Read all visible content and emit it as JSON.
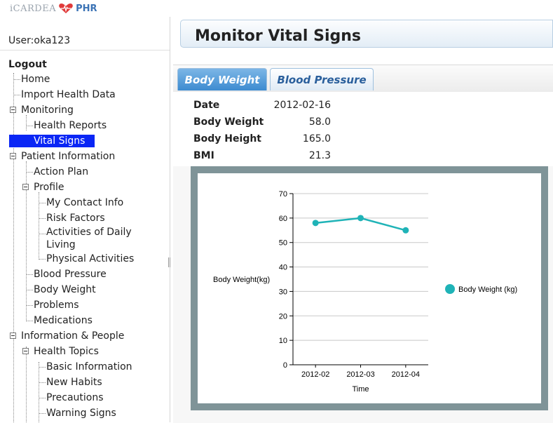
{
  "brand": {
    "name": "iCARDEA",
    "suffix": "PHR",
    "heart_color": "#e03a3a"
  },
  "sidebar": {
    "user_label": "User:",
    "username": "oka123",
    "logout": "Logout",
    "items": [
      {
        "label": "Home"
      },
      {
        "label": "Import Health Data"
      },
      {
        "label": "Monitoring"
      },
      {
        "label": "Health Reports"
      },
      {
        "label": "Vital Signs"
      },
      {
        "label": "Patient Information"
      },
      {
        "label": "Action Plan"
      },
      {
        "label": "Profile"
      },
      {
        "label": "My Contact Info"
      },
      {
        "label": "Risk Factors"
      },
      {
        "label": "Activities of Daily"
      },
      {
        "label": "Living"
      },
      {
        "label": "Physical Activities"
      },
      {
        "label": "Blood Pressure"
      },
      {
        "label": "Body Weight"
      },
      {
        "label": "Problems"
      },
      {
        "label": "Medications"
      },
      {
        "label": "Information & People"
      },
      {
        "label": "Health Topics"
      },
      {
        "label": "Basic Information"
      },
      {
        "label": "New Habits"
      },
      {
        "label": "Precautions"
      },
      {
        "label": "Warning Signs"
      }
    ]
  },
  "main": {
    "title": "Monitor Vital Signs",
    "tabs": [
      {
        "label": "Body Weight",
        "active": true
      },
      {
        "label": "Blood Pressure",
        "active": false
      }
    ],
    "info": {
      "date_label": "Date",
      "date_value": "2012-02-16",
      "weight_label": "Body Weight",
      "weight_value": "58.0",
      "height_label": "Body Height",
      "height_value": "165.0",
      "bmi_label": "BMI",
      "bmi_value": "21.3"
    }
  },
  "chart_data": {
    "type": "line",
    "categories": [
      "2012-02",
      "2012-03",
      "2012-04"
    ],
    "series": [
      {
        "name": "Body Weight (kg)",
        "values": [
          58,
          60,
          55
        ],
        "color": "#1fb3b7"
      }
    ],
    "ylabel": "Body Weight(kg)",
    "xlabel": "Time",
    "ylim": [
      0,
      70
    ],
    "yticks": [
      0,
      10,
      20,
      30,
      40,
      50,
      60,
      70
    ],
    "grid": true,
    "legend": "right"
  }
}
